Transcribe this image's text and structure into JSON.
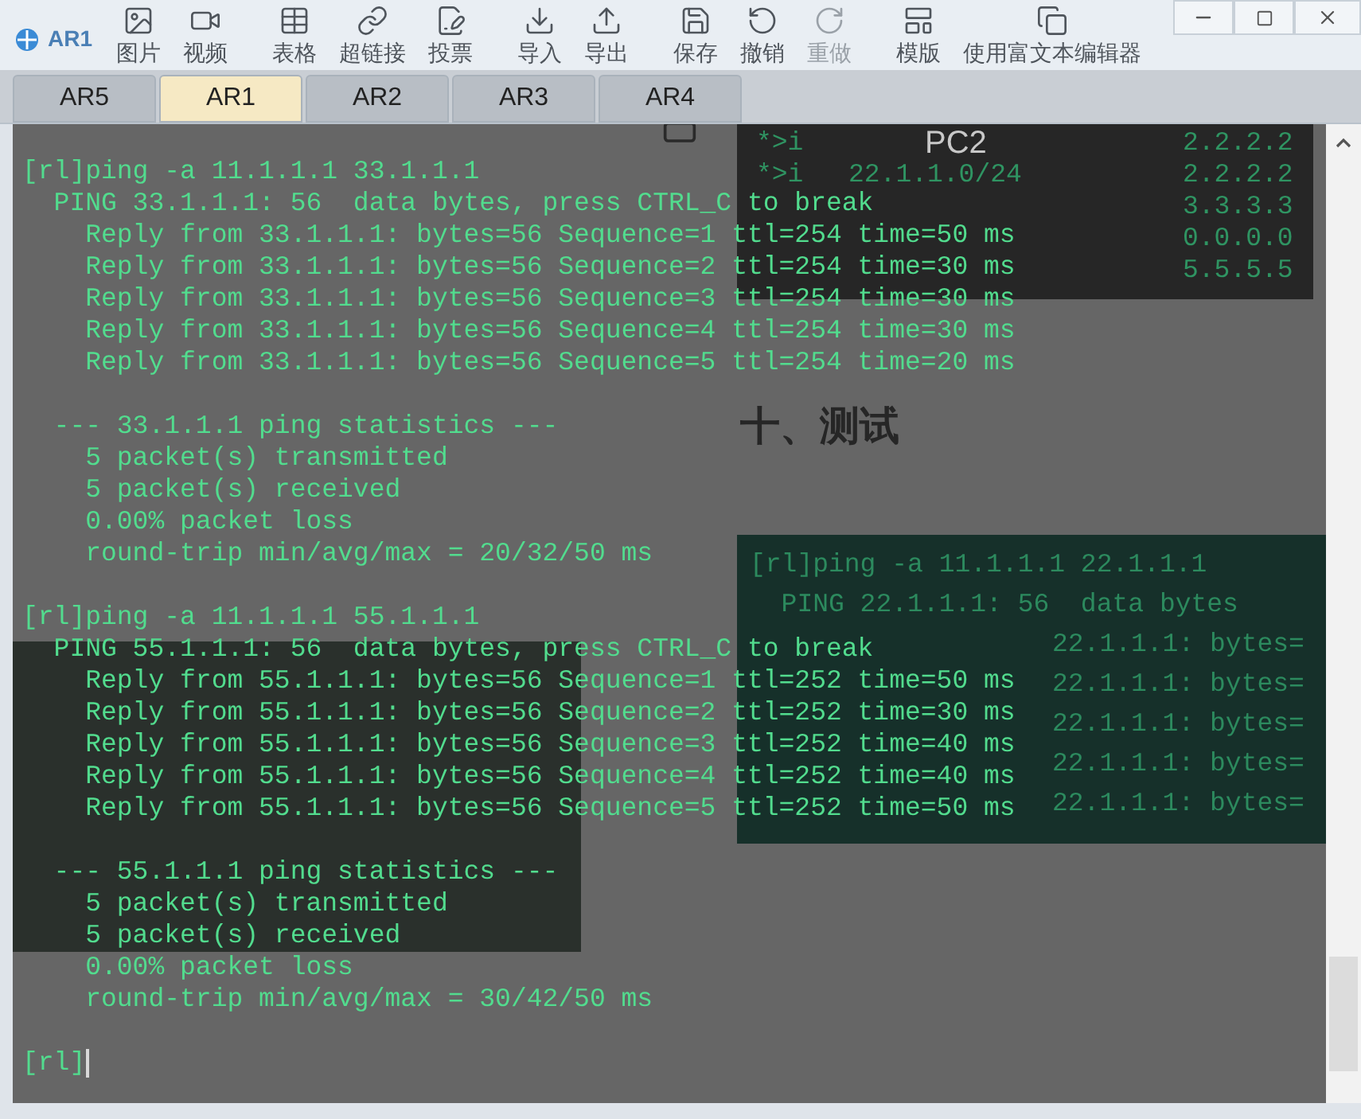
{
  "window": {
    "title": "AR1"
  },
  "toolbar": {
    "groups": [
      [
        {
          "kind": "image",
          "label": "图片",
          "disabled": false
        },
        {
          "kind": "video",
          "label": "视频",
          "disabled": false
        }
      ],
      [
        {
          "kind": "table",
          "label": "表格",
          "disabled": false
        },
        {
          "kind": "link",
          "label": "超链接",
          "disabled": false
        },
        {
          "kind": "vote",
          "label": "投票",
          "disabled": false
        }
      ],
      [
        {
          "kind": "import",
          "label": "导入",
          "disabled": false
        },
        {
          "kind": "export",
          "label": "导出",
          "disabled": false
        }
      ],
      [
        {
          "kind": "save",
          "label": "保存",
          "disabled": false
        },
        {
          "kind": "undo",
          "label": "撤销",
          "disabled": false
        },
        {
          "kind": "redo",
          "label": "重做",
          "disabled": true
        }
      ],
      [
        {
          "kind": "template",
          "label": "模版",
          "disabled": false
        },
        {
          "kind": "rich",
          "label": "使用富文本编辑器",
          "disabled": false
        }
      ]
    ]
  },
  "tabs": [
    {
      "label": "AR5",
      "selected": false
    },
    {
      "label": "AR1",
      "selected": true
    },
    {
      "label": "AR2",
      "selected": false
    },
    {
      "label": "AR3",
      "selected": false
    },
    {
      "label": "AR4",
      "selected": false
    }
  ],
  "terminal": {
    "blocks": [
      [
        "[rl]ping -a 11.1.1.1 33.1.1.1",
        "  PING 33.1.1.1: 56  data bytes, press CTRL_C to break",
        "    Reply from 33.1.1.1: bytes=56 Sequence=1 ttl=254 time=50 ms",
        "    Reply from 33.1.1.1: bytes=56 Sequence=2 ttl=254 time=30 ms",
        "    Reply from 33.1.1.1: bytes=56 Sequence=3 ttl=254 time=30 ms",
        "    Reply from 33.1.1.1: bytes=56 Sequence=4 ttl=254 time=30 ms",
        "    Reply from 33.1.1.1: bytes=56 Sequence=5 ttl=254 time=20 ms"
      ],
      [
        "  --- 33.1.1.1 ping statistics ---",
        "    5 packet(s) transmitted",
        "    5 packet(s) received",
        "    0.00% packet loss",
        "    round-trip min/avg/max = 20/32/50 ms"
      ],
      [
        "[rl]ping -a 11.1.1.1 55.1.1.1",
        "  PING 55.1.1.1: 56  data bytes, press CTRL_C to break",
        "    Reply from 55.1.1.1: bytes=56 Sequence=1 ttl=252 time=50 ms",
        "    Reply from 55.1.1.1: bytes=56 Sequence=2 ttl=252 time=30 ms",
        "    Reply from 55.1.1.1: bytes=56 Sequence=3 ttl=252 time=40 ms",
        "    Reply from 55.1.1.1: bytes=56 Sequence=4 ttl=252 time=40 ms",
        "    Reply from 55.1.1.1: bytes=56 Sequence=5 ttl=252 time=50 ms"
      ],
      [
        "  --- 55.1.1.1 ping statistics ---",
        "    5 packet(s) transmitted",
        "    5 packet(s) received",
        "    0.00% packet loss",
        "    round-trip min/avg/max = 30/42/50 ms"
      ]
    ],
    "prompt": "[rl]"
  },
  "route_panel": {
    "label": "PC2",
    "rows": [
      {
        "flag": "*>i",
        "next_hop": "2.2.2.2"
      },
      {
        "flag": "*>i",
        "network": "22.1.1.0/24",
        "next_hop": "2.2.2.2"
      },
      {
        "next_hop": "3.3.3.3"
      },
      {
        "next_hop": "0.0.0.0"
      },
      {
        "next_hop": "5.5.5.5"
      }
    ]
  },
  "heading": "十、测试",
  "ping_panel": {
    "lines": [
      "[rl]ping -a 11.1.1.1 22.1.1.1",
      "  PING 22.1.1.1: 56  data bytes"
    ],
    "reply_tails": [
      "22.1.1.1: bytes=",
      "22.1.1.1: bytes=",
      "22.1.1.1: bytes=",
      "22.1.1.1: bytes=",
      "22.1.1.1: bytes="
    ]
  }
}
